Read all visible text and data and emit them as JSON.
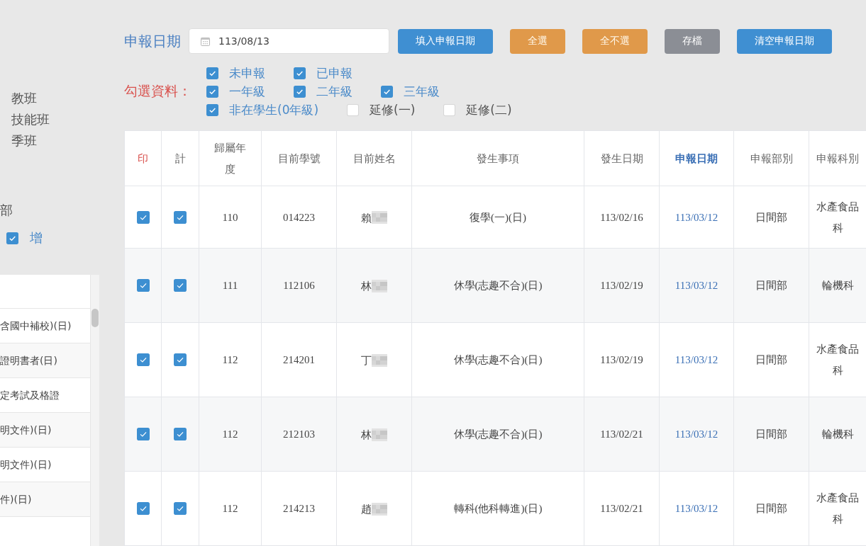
{
  "sidebar": {
    "items": [
      "教班",
      "技能班",
      "季班"
    ],
    "department": "部",
    "option": {
      "label": "增",
      "checked": true
    },
    "list": {
      "rows": [
        "含國中補校)(日)",
        "證明書者(日)",
        "定考試及格證",
        "明文件)(日)",
        "明文件)(日)",
        "件)(日)"
      ]
    }
  },
  "report_date": {
    "label": "申報日期",
    "value": "113/08/13"
  },
  "buttons": [
    {
      "label": "填入申報日期",
      "kind": "primary"
    },
    {
      "label": "全選",
      "kind": "warning"
    },
    {
      "label": "全不選",
      "kind": "warning"
    },
    {
      "label": "存檔",
      "kind": "secondary"
    },
    {
      "label": "清空申報日期",
      "kind": "primary"
    }
  ],
  "filters": {
    "label": "勾選資料：",
    "rows": [
      {
        "options": [
          {
            "label": "未申報",
            "checked": true
          },
          {
            "label": "已申報",
            "checked": true
          }
        ]
      },
      {
        "options": [
          {
            "label": "一年級",
            "checked": true
          },
          {
            "label": "二年級",
            "checked": true
          },
          {
            "label": "三年級",
            "checked": true
          }
        ]
      },
      {
        "options": [
          {
            "label": "非在學生(0年級)",
            "checked": true
          },
          {
            "label": "延修(一)",
            "checked": false
          },
          {
            "label": "延修(二)",
            "checked": false
          }
        ]
      }
    ]
  },
  "table": {
    "columns": [
      {
        "label": "印",
        "kind": "check",
        "color": "#d9534f"
      },
      {
        "label": "計",
        "kind": "check"
      },
      {
        "label": "歸屬年度",
        "kind": "text"
      },
      {
        "label": "目前學號",
        "kind": "text"
      },
      {
        "label": "目前姓名",
        "kind": "name"
      },
      {
        "label": "發生事項",
        "kind": "text"
      },
      {
        "label": "發生日期",
        "kind": "text"
      },
      {
        "label": "申報日期",
        "kind": "key",
        "color": "#3a6fb5"
      },
      {
        "label": "申報部別",
        "kind": "text"
      },
      {
        "label": "申報科別",
        "kind": "text"
      }
    ],
    "rows": [
      {
        "cells": [
          {
            "checked": true
          },
          {
            "checked": true
          },
          {
            "text": "110"
          },
          {
            "text": "014223"
          },
          {
            "text": "賴"
          },
          {
            "text": "復學(一)(日)"
          },
          {
            "text": "113/02/16"
          },
          {
            "text": "113/03/12"
          },
          {
            "text": "日間部"
          },
          {
            "text": "水產食品科"
          }
        ]
      },
      {
        "cells": [
          {
            "checked": true
          },
          {
            "checked": true
          },
          {
            "text": "111"
          },
          {
            "text": "112106"
          },
          {
            "text": "林"
          },
          {
            "text": "休學(志趣不合)(日)"
          },
          {
            "text": "113/02/19"
          },
          {
            "text": "113/03/12"
          },
          {
            "text": "日間部"
          },
          {
            "text": "輪機科"
          }
        ]
      },
      {
        "cells": [
          {
            "checked": true
          },
          {
            "checked": true
          },
          {
            "text": "112"
          },
          {
            "text": "214201"
          },
          {
            "text": "丁"
          },
          {
            "text": "休學(志趣不合)(日)"
          },
          {
            "text": "113/02/19"
          },
          {
            "text": "113/03/12"
          },
          {
            "text": "日間部"
          },
          {
            "text": "水產食品科"
          }
        ]
      },
      {
        "cells": [
          {
            "checked": true
          },
          {
            "checked": true
          },
          {
            "text": "112"
          },
          {
            "text": "212103"
          },
          {
            "text": "林"
          },
          {
            "text": "休學(志趣不合)(日)"
          },
          {
            "text": "113/02/21"
          },
          {
            "text": "113/03/12"
          },
          {
            "text": "日間部"
          },
          {
            "text": "輪機科"
          }
        ]
      },
      {
        "cells": [
          {
            "checked": true
          },
          {
            "checked": true
          },
          {
            "text": "112"
          },
          {
            "text": "214213"
          },
          {
            "text": "趙"
          },
          {
            "text": "轉科(他科轉進)(日)"
          },
          {
            "text": "113/02/21"
          },
          {
            "text": "113/03/12"
          },
          {
            "text": "日間部"
          },
          {
            "text": "水產食品科"
          }
        ]
      }
    ]
  }
}
